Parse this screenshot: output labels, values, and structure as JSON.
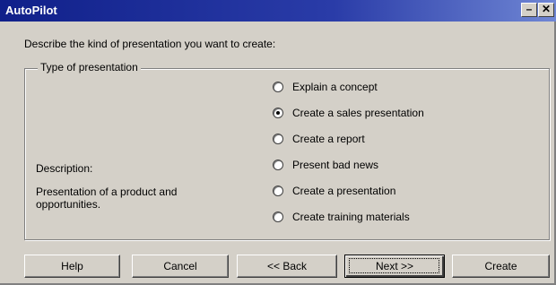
{
  "window": {
    "title": "AutoPilot",
    "minimize_glyph": "–",
    "close_glyph": "✕"
  },
  "prompt": "Describe the kind of presentation you want to create:",
  "group": {
    "legend": "Type of presentation",
    "description_label": "Description:",
    "description_text": "Presentation of a product and opportunities.",
    "options": [
      {
        "label": "Explain a concept",
        "selected": false
      },
      {
        "label": "Create a sales presentation",
        "selected": true
      },
      {
        "label": "Create a report",
        "selected": false
      },
      {
        "label": "Present bad news",
        "selected": false
      },
      {
        "label": "Create a presentation",
        "selected": false
      },
      {
        "label": "Create training materials",
        "selected": false
      }
    ]
  },
  "buttons": {
    "help": "Help",
    "cancel": "Cancel",
    "back": "<< Back",
    "next": "Next >>",
    "create": "Create"
  },
  "colors": {
    "title_bar": "#10208a",
    "face": "#d4d0c8"
  }
}
